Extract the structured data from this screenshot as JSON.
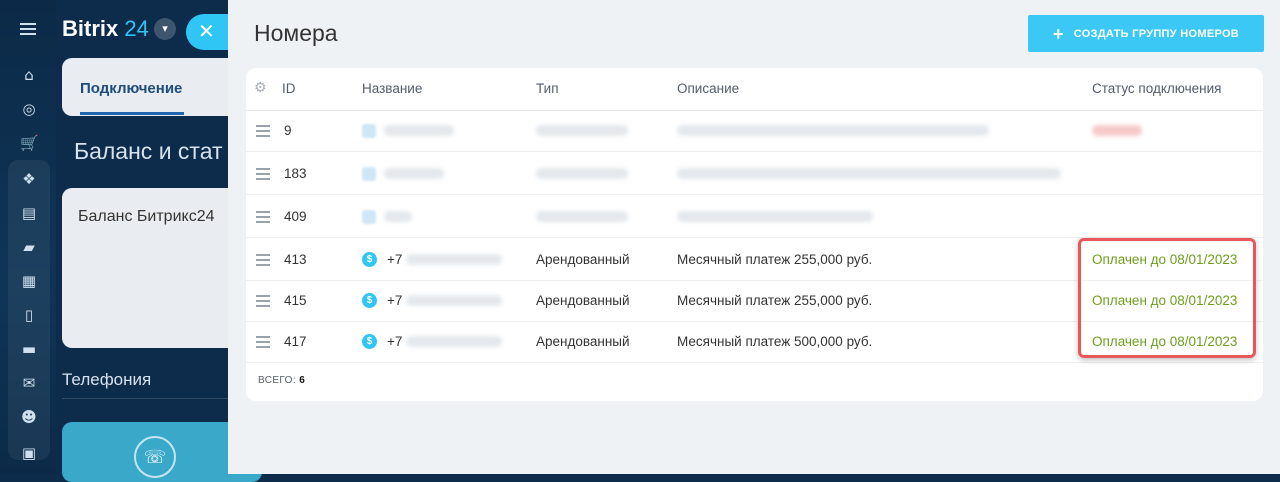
{
  "sidebar": {
    "icons": [
      "menu-icon",
      "home-icon",
      "target-icon",
      "cart-icon",
      "crm-icon",
      "feed-icon",
      "chat-icon",
      "calendar-icon",
      "document-icon",
      "drive-icon",
      "mail-icon",
      "users-icon",
      "contact-card-icon"
    ]
  },
  "background": {
    "logo_text": "Bitrix",
    "logo_num": "24",
    "tab_label": "Подключение",
    "balance_title": "Баланс и стат",
    "balance_card_label": "Баланс Битрикс24",
    "telephony_label": "Телефония"
  },
  "slider": {
    "title": "Номера",
    "create_button": "СОЗДАТЬ ГРУППУ НОМЕРОВ",
    "columns": {
      "id": "ID",
      "name": "Название",
      "type": "Тип",
      "description": "Описание",
      "status": "Статус подключения"
    },
    "rows": [
      {
        "id": "9",
        "name": "",
        "type": "",
        "description": "",
        "status": ""
      },
      {
        "id": "183",
        "name": "",
        "type": "",
        "description": "",
        "status": ""
      },
      {
        "id": "409",
        "name": "",
        "type": "",
        "description": "",
        "status": ""
      },
      {
        "id": "413",
        "name": "+7",
        "type": "Арендованный",
        "description": "Месячный платеж 255,000 руб.",
        "status": "Оплачен до 08/01/2023"
      },
      {
        "id": "415",
        "name": "+7",
        "type": "Арендованный",
        "description": "Месячный платеж 255,000 руб.",
        "status": "Оплачен до 08/01/2023"
      },
      {
        "id": "417",
        "name": "+7",
        "type": "Арендованный",
        "description": "Месячный платеж 500,000 руб.",
        "status": "Оплачен до 08/01/2023"
      }
    ],
    "total_label": "ВСЕГО:",
    "total_value": "6"
  },
  "colors": {
    "accent": "#3bc8f5",
    "status_ok": "#6c9e1c",
    "highlight": "#e8585a"
  }
}
